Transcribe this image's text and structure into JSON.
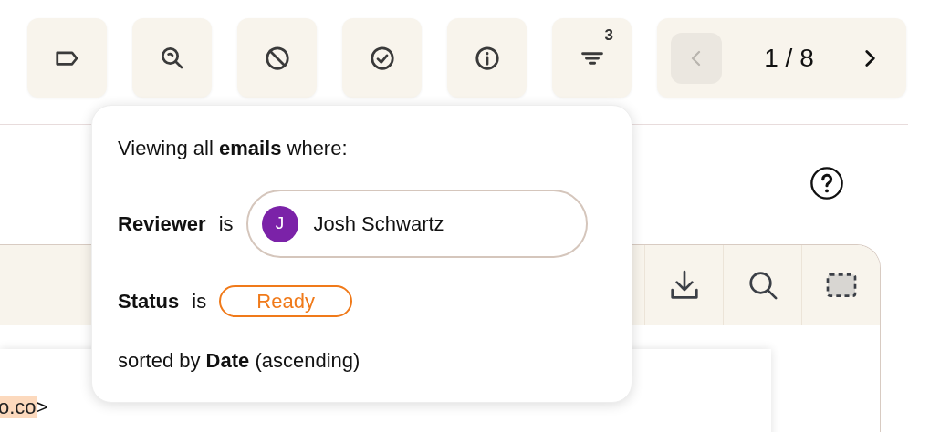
{
  "toolbar": {
    "buttons": [
      {
        "kind": "tag"
      },
      {
        "kind": "zoom"
      },
      {
        "kind": "block"
      },
      {
        "kind": "check"
      },
      {
        "kind": "info"
      },
      {
        "kind": "filter",
        "badge": "3"
      }
    ],
    "pager": {
      "prev_disabled": true,
      "next_disabled": false,
      "text": "1 / 8"
    }
  },
  "help": {
    "kind": "help"
  },
  "filter_popover": {
    "intro": "Viewing all **emails** where:",
    "conditions": [
      {
        "kind": "user",
        "field": "Reviewer",
        "operator": "is",
        "avatar": "J",
        "value": "Josh Schwartz",
        "color": "#7b22a8"
      },
      {
        "kind": "status",
        "field": "Status",
        "operator": "is",
        "value": "Ready",
        "color": "#f07a1a"
      }
    ],
    "sort": "sorted by **Date** (ascending)"
  },
  "viewer": {
    "tools": [
      {
        "kind": "download"
      },
      {
        "kind": "search"
      },
      {
        "kind": "select"
      }
    ],
    "snippet": [
      {
        "text": "o.co",
        "highlighted": true
      },
      {
        "text": ">",
        "highlighted": false
      }
    ]
  }
}
